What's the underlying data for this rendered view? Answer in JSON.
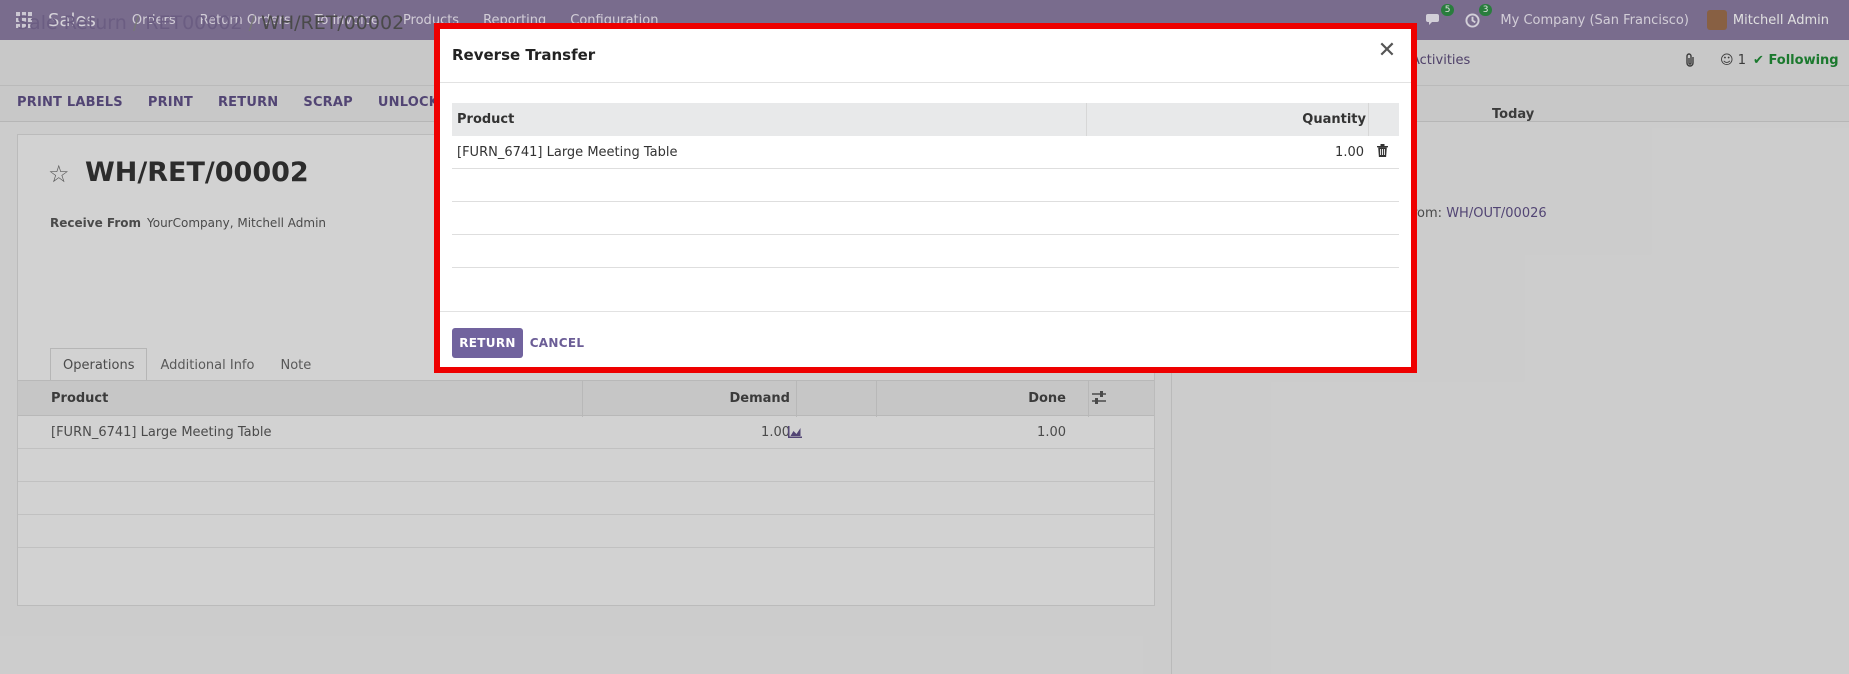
{
  "navbar": {
    "brand": "Sales",
    "menu": [
      "Orders",
      "Return Orders",
      "To Invoice",
      "Products",
      "Reporting",
      "Configuration"
    ],
    "messages_count": "5",
    "activities_count": "3",
    "company": "My Company (San Francisco)",
    "user": "Mitchell Admin"
  },
  "breadcrumb": {
    "parent1": "Sale Return",
    "parent2": "RET00002",
    "current": "WH/RET/00002",
    "separator": "/"
  },
  "actions": [
    "PRINT LABELS",
    "PRINT",
    "RETURN",
    "SCRAP",
    "UNLOCK"
  ],
  "chatter": {
    "activities": "Activities",
    "followers": "1",
    "following": "Following",
    "today": "Today",
    "message_prefix": "rom: ",
    "message_link": "WH/OUT/00026"
  },
  "form": {
    "title": "WH/RET/00002",
    "receive_from_label": "Receive From",
    "receive_from_value": "YourCompany, Mitchell Admin",
    "tabs": [
      "Operations",
      "Additional Info",
      "Note"
    ],
    "ops_headers": {
      "product": "Product",
      "demand": "Demand",
      "done": "Done"
    },
    "ops_rows": [
      {
        "product": "[FURN_6741] Large Meeting Table",
        "demand": "1.00",
        "done": "1.00"
      }
    ]
  },
  "modal": {
    "title": "Reverse Transfer",
    "headers": {
      "product": "Product",
      "quantity": "Quantity"
    },
    "rows": [
      {
        "product": "[FURN_6741] Large Meeting Table",
        "quantity": "1.00"
      }
    ],
    "return_label": "RETURN",
    "cancel_label": "CANCEL"
  }
}
